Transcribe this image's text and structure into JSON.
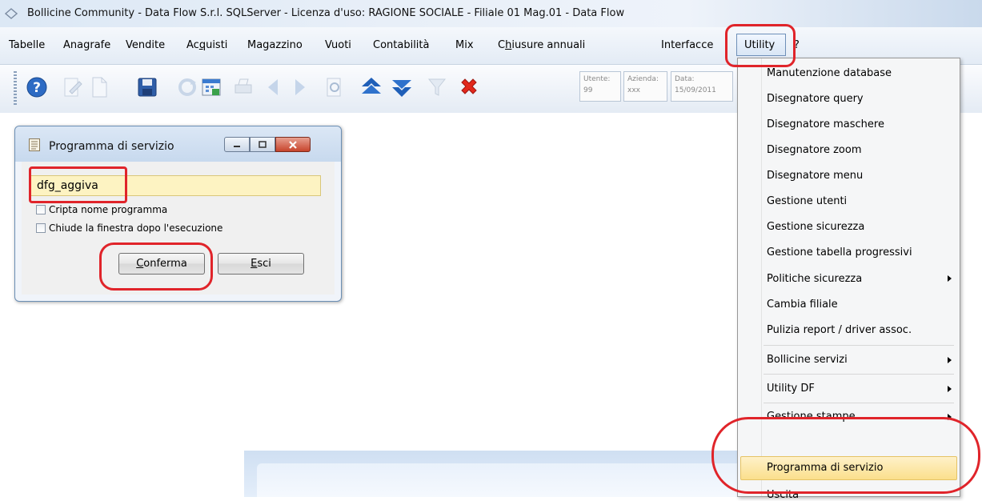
{
  "window": {
    "title": "Bollicine Community - Data Flow S.r.l. SQLServer - Licenza d'uso: RAGIONE SOCIALE - Filiale 01     Mag.01     - Data Flow"
  },
  "menubar": {
    "items": [
      {
        "pre": "Tabelle",
        "ul": "",
        "post": ""
      },
      {
        "pre": "Anagrafe",
        "ul": "",
        "post": ""
      },
      {
        "pre": "Vendite",
        "ul": "",
        "post": ""
      },
      {
        "pre": "Ac",
        "ul": "q",
        "post": "uisti"
      },
      {
        "pre": "Magazzino",
        "ul": "",
        "post": ""
      },
      {
        "pre": "Vuoti",
        "ul": "",
        "post": ""
      },
      {
        "pre": "Contabilità",
        "ul": "",
        "post": ""
      },
      {
        "pre": "Mix",
        "ul": "",
        "post": ""
      },
      {
        "pre": "C",
        "ul": "h",
        "post": "iusure annuali"
      },
      {
        "pre": "Interfacce",
        "ul": "",
        "post": ""
      },
      {
        "pre": "Utility",
        "ul": "",
        "post": ""
      },
      {
        "pre": "?",
        "ul": "",
        "post": ""
      }
    ]
  },
  "toolbar": {
    "icons": [
      "help-icon",
      "edit-icon",
      "new-document-icon",
      "save-icon",
      "refresh-icon",
      "calendar-icon",
      "print-icon",
      "previous-icon",
      "next-icon",
      "preview-icon",
      "move-up-icon",
      "move-down-icon",
      "filter-icon",
      "delete-icon"
    ],
    "info": {
      "utente_label": "Utente:",
      "utente_value": "99",
      "azienda_label": "Azienda:",
      "azienda_value": "xxx",
      "data_label": "Data:",
      "data_value": "15/09/2011"
    }
  },
  "dialog": {
    "title": "Programma di servizio",
    "input_value": "dfg_aggiva",
    "checkbox_encrypt": "Cripta nome programma",
    "checkbox_close": "Chiude la finestra dopo l'esecuzione",
    "confirm_ul": "C",
    "confirm_rest": "onferma",
    "exit_ul": "E",
    "exit_rest": "sci"
  },
  "dropdown": {
    "items": [
      {
        "label": "Manutenzione database",
        "submenu": false
      },
      {
        "label": "Disegnatore query",
        "submenu": false
      },
      {
        "label": "Disegnatore maschere",
        "submenu": false
      },
      {
        "label": "Disegnatore zoom",
        "submenu": false
      },
      {
        "label": "Disegnatore menu",
        "submenu": false
      },
      {
        "label": "Gestione utenti",
        "submenu": false
      },
      {
        "label": "Gestione sicurezza",
        "submenu": false
      },
      {
        "label": "Gestione tabella progressivi",
        "submenu": false
      },
      {
        "label": "Politiche sicurezza",
        "submenu": true
      },
      {
        "label": "Cambia filiale",
        "submenu": false
      },
      {
        "label": "Pulizia report / driver assoc.",
        "submenu": false
      },
      {
        "label": "Bollicine servizi",
        "submenu": true
      },
      {
        "label": "Utility DF",
        "submenu": true
      },
      {
        "label": "Gestione stampe",
        "submenu": true
      },
      {
        "label": "Programma di servizio",
        "submenu": false,
        "highlighted": true
      },
      {
        "label": "Uscita",
        "submenu": false
      }
    ]
  },
  "colors": {
    "annotation": "#e0242a",
    "highlight": "#fbdf8c",
    "input_bg": "#fdf3c2"
  }
}
